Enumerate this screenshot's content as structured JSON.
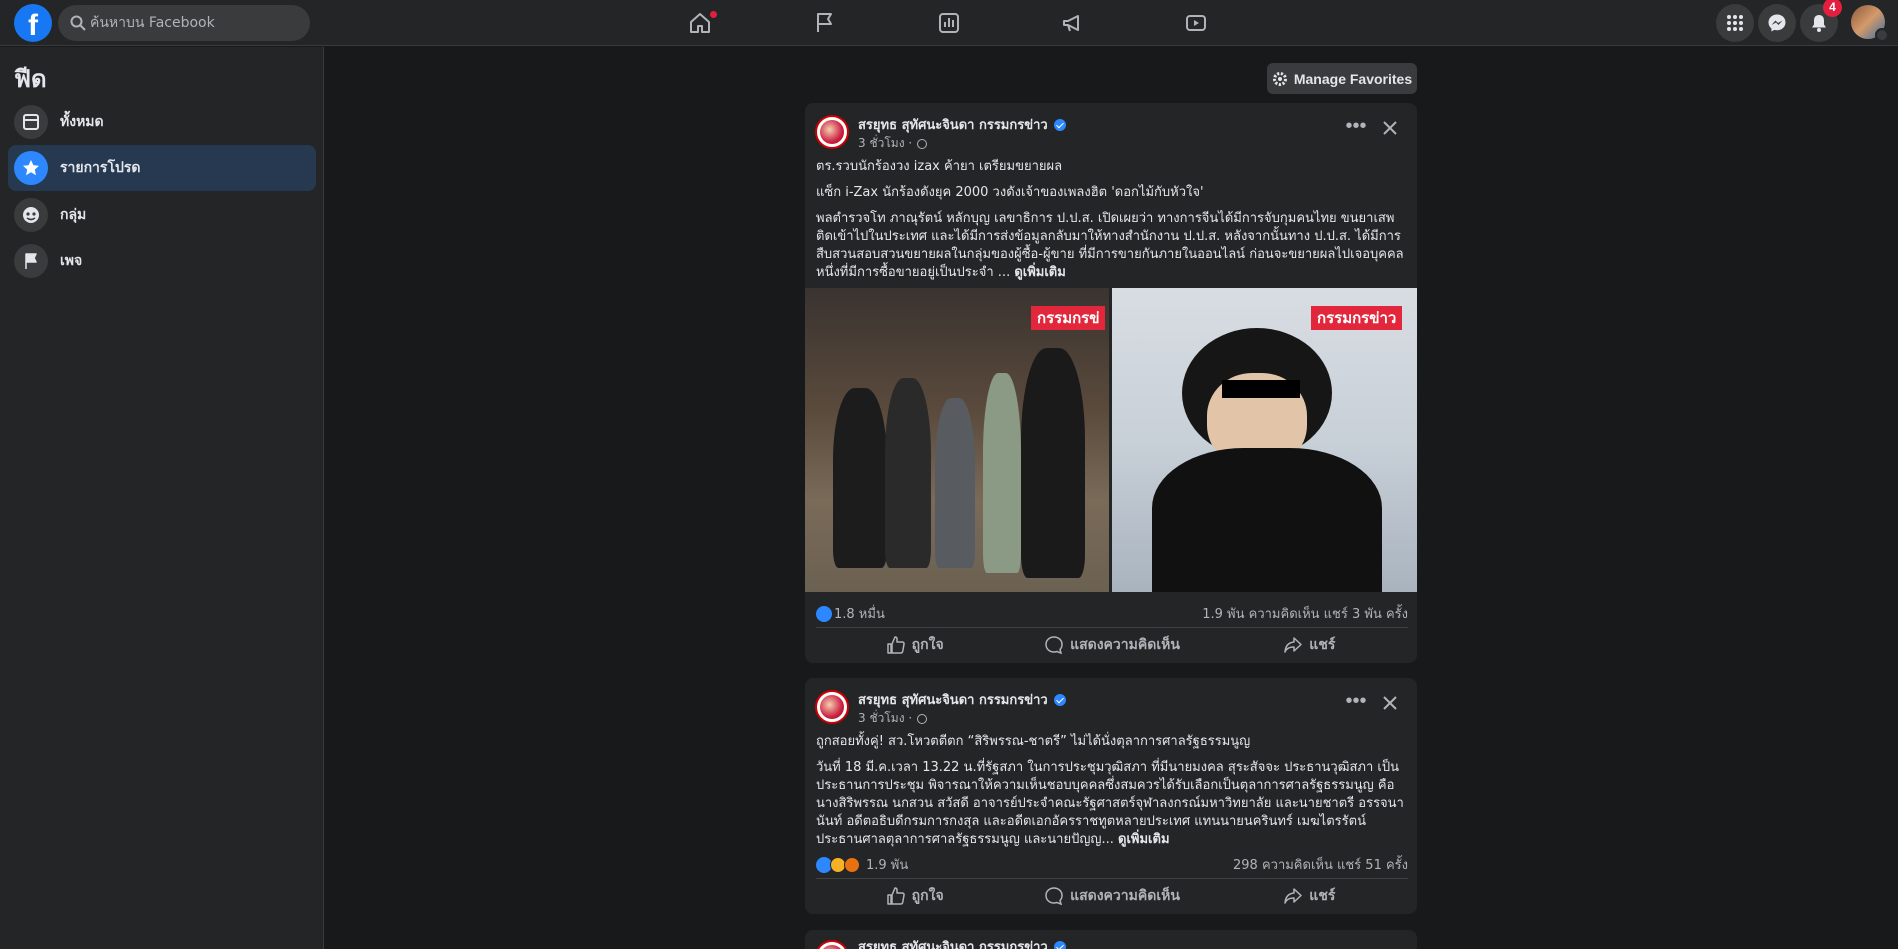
{
  "search": {
    "placeholder": "ค้นหาบน Facebook"
  },
  "notifications": {
    "count": "4"
  },
  "sidebar": {
    "title": "ฟีด",
    "items": [
      {
        "label": "ทั้งหมด",
        "icon": "feed-icon"
      },
      {
        "label": "รายการโปรด",
        "icon": "star-icon"
      },
      {
        "label": "กลุ่ม",
        "icon": "groups-icon"
      },
      {
        "label": "เพจ",
        "icon": "flag-icon"
      }
    ]
  },
  "manage_favorites": "Manage Favorites",
  "colors": {
    "accent": "#2d88ff",
    "background": "#18191a",
    "surface": "#242526",
    "badge": "#e41e3f"
  },
  "posts": [
    {
      "author": "สรยุทธ สุทัศนะจินดา กรรมกรข่าว",
      "time": "3 ชั่วโมง ·",
      "lines": [
        "ตร.รวบนักร้องวง izax ค้ายา เตรียมขยายผล",
        "แซ็ก i-Zax นักร้องดังยุค 2000 วงดังเจ้าของเพลงฮิต 'ดอกไม้กับหัวใจ'",
        "พลตำรวจโท ภาณุรัตน์ หลักบุญ เลขาธิการ ป.ป.ส. เปิดเผยว่า ทางการจีนได้มีการจับกุมคนไทย ขนยาเสพติดเข้าไปในประเทศ และได้มีการส่งข้อมูลกลับมาให้ทางสำนักงาน ป.ป.ส. หลังจากนั้นทาง ป.ป.ส. ได้มีการสืบสวนสอบสวนขยายผลในกลุ่มของผู้ซื้อ-ผู้ขาย ที่มีการขายกันภายในออนไลน์ ก่อนจะขยายผลไปเจอบุคคลหนึ่งที่มีการซื้อขายอยู่เป็นประจำ ..."
      ],
      "see_more": "ดูเพิ่มเติม",
      "photo_tag": "กรรมกรข่าว",
      "photo_tag_cut": "กรรมกรข่",
      "reactions": "1.8 หมื่น",
      "comments_shares": "1.9 พัน ความคิดเห็น   แชร์ 3 พัน ครั้ง",
      "actions": {
        "like": "ถูกใจ",
        "comment": "แสดงความคิดเห็น",
        "share": "แชร์"
      }
    },
    {
      "author": "สรยุทธ สุทัศนะจินดา กรรมกรข่าว",
      "time": "3 ชั่วโมง ·",
      "lines": [
        "ถูกสอยทั้งคู่! สว.โหวตตีตก “สิริพรรณ-ชาตรี” ไม่ได้นั่งตุลาการศาลรัฐธรรมนูญ",
        "วันที่ 18 มี.ค.เวลา 13.22 น.ที่รัฐสภา ในการประชุมวุฒิสภา ที่มีนายมงคล สุระสัจจะ ประธานวุฒิสภา เป็นประธานการประชุม พิจารณาให้ความเห็นชอบบุคคลซึ่งสมควรได้รับเลือกเป็นตุลาการศาลรัฐธรรมนูญ คือ นางสิริพรรณ นกสวน สวัสดี อาจารย์ประจำคณะรัฐศาสตร์จุฬาลงกรณ์มหาวิทยาลัย และนายชาตรี อรรจนานันท์ อดีตอธิบดีกรมการกงสุล และอดีตเอกอัครราชทูตหลายประเทศ แทนนายนครินทร์ เมฆไตรรัตน์ ประธานศาลตุลาการศาลรัฐธรรมนูญ และนายปัญญ..."
      ],
      "see_more": "ดูเพิ่มเติม",
      "reactions": "1.9 พัน",
      "comments_shares": "298 ความคิดเห็น   แชร์ 51 ครั้ง",
      "actions": {
        "like": "ถูกใจ",
        "comment": "แสดงความคิดเห็น",
        "share": "แชร์"
      }
    },
    {
      "author": "สรยุทธ สุทัศนะจินดา กรรมกรข่าว"
    }
  ]
}
